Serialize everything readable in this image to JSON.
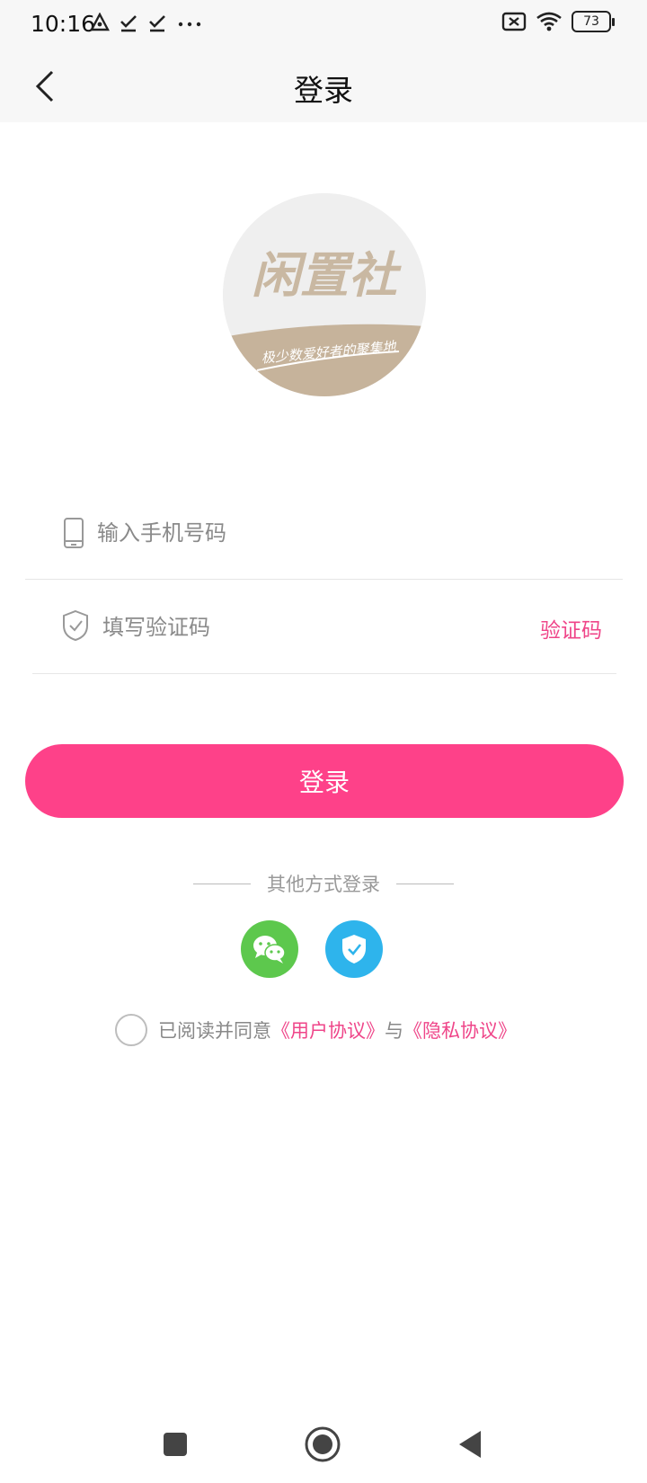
{
  "status_bar": {
    "time": "10:16",
    "battery": "73",
    "icons": [
      "navigation-icon",
      "download-done-icon",
      "download-done-icon",
      "more-dots-icon",
      "sim-off-icon",
      "wifi-icon",
      "battery-icon"
    ]
  },
  "header": {
    "title": "登录",
    "back_icon": "chevron-left-icon"
  },
  "logo": {
    "brand_text": "闲置社",
    "tagline": "极少数爱好者的聚集地"
  },
  "form": {
    "phone_placeholder": "输入手机号码",
    "phone_value": "",
    "code_placeholder": "填写验证码",
    "code_value": "",
    "code_button": "验证码"
  },
  "login_button": "登录",
  "other_login": {
    "label": "其他方式登录",
    "providers": [
      "wechat-icon",
      "shield-icon"
    ]
  },
  "agreement": {
    "prefix": "已阅读并同意",
    "user_agreement": "《用户协议》",
    "joiner": "与",
    "privacy_policy": "《隐私协议》",
    "checked": false
  },
  "nav_bar": {
    "items": [
      "recents-square-icon",
      "home-circle-icon",
      "back-triangle-icon"
    ]
  },
  "colors": {
    "accent": "#fe4189",
    "link": "#ef4589",
    "wechat": "#5dc84d",
    "shield": "#2eb4ec",
    "logo_band": "#c6b39b",
    "logo_text": "#c9b8a2"
  }
}
